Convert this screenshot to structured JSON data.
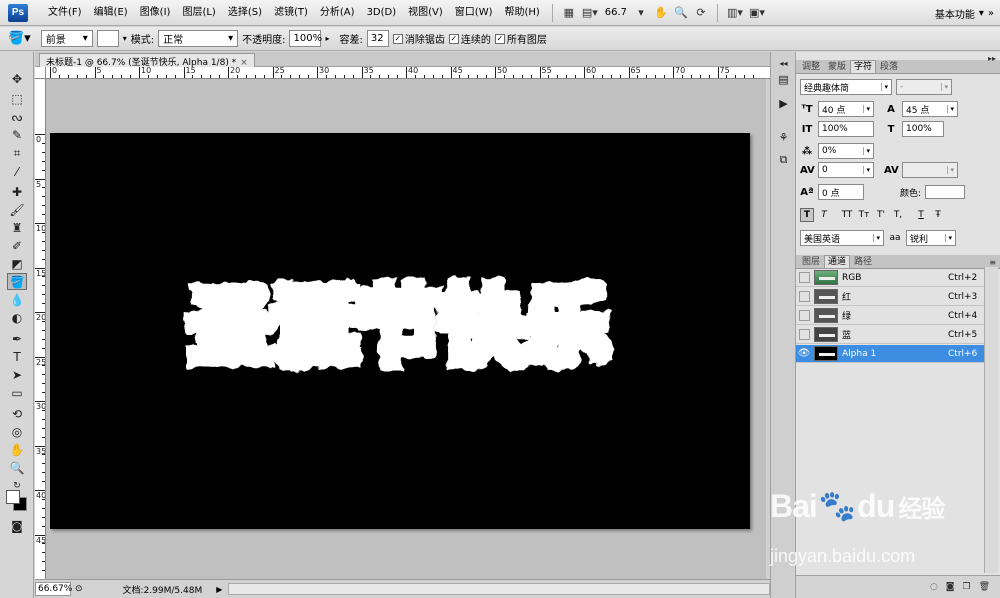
{
  "app": {
    "logo": "Ps"
  },
  "menu": {
    "items": [
      "文件(F)",
      "编辑(E)",
      "图像(I)",
      "图层(L)",
      "选择(S)",
      "滤镜(T)",
      "分析(A)",
      "3D(D)",
      "视图(V)",
      "窗口(W)",
      "帮助(H)"
    ],
    "zoom": "66.7",
    "workspace": "基本功能"
  },
  "options": {
    "fill_source": "前景",
    "mode_label": "模式:",
    "mode_value": "正常",
    "opacity_label": "不透明度:",
    "opacity_value": "100%",
    "tolerance_label": "容差:",
    "tolerance_value": "32",
    "antialias_label": "消除锯齿",
    "contiguous_label": "连续的",
    "all_layers_label": "所有图层",
    "check_mark": "✓"
  },
  "document": {
    "tab_title": "未标题-1 @ 66.7% (圣诞节快乐, Alpha 1/8) *",
    "close": "×",
    "canvas_text": "圣诞节快乐",
    "ruler_h": [
      "0",
      "5",
      "10",
      "15",
      "20",
      "25",
      "30",
      "35",
      "40",
      "45",
      "50",
      "55",
      "60",
      "65",
      "70",
      "75"
    ],
    "ruler_v": [
      "0",
      "5",
      "10",
      "15",
      "20",
      "25",
      "30",
      "35",
      "40",
      "45"
    ]
  },
  "status": {
    "zoom": "66.67%",
    "doc_info": "文档:2.99M/5.48M",
    "arrow": "▶"
  },
  "panels": {
    "top_tabs": [
      "调整",
      "蒙版",
      "字符",
      "段落"
    ],
    "top_active": 2,
    "character": {
      "font_family": "经典趣体简",
      "font_style": "-",
      "size": "40 点",
      "leading": "45 点",
      "vscale": "100%",
      "hscale": "100%",
      "tracking_pct": "0%",
      "kerning": "0",
      "baseline": "0 点",
      "color_label": "颜色:",
      "language": "美国英语",
      "antialias_icon": "aa",
      "antialias": "锐利",
      "styles": [
        "T",
        "T",
        "TT",
        "Tт",
        "T'",
        "T,",
        "T",
        "Ŧ"
      ]
    },
    "bottom_tabs": [
      "图层",
      "通道",
      "路径"
    ],
    "bottom_active": 1,
    "channels": [
      {
        "name": "RGB",
        "shortcut": "Ctrl+2",
        "visible": false,
        "selected": false
      },
      {
        "name": "红",
        "shortcut": "Ctrl+3",
        "visible": false,
        "selected": false
      },
      {
        "name": "绿",
        "shortcut": "Ctrl+4",
        "visible": false,
        "selected": false
      },
      {
        "name": "蓝",
        "shortcut": "Ctrl+5",
        "visible": false,
        "selected": false
      },
      {
        "name": "Alpha 1",
        "shortcut": "Ctrl+6",
        "visible": true,
        "selected": true
      }
    ]
  },
  "watermark": {
    "brand_left": "Bai",
    "brand_right": "du",
    "brand_cn": "经验",
    "url": "jingyan.baidu.com"
  }
}
